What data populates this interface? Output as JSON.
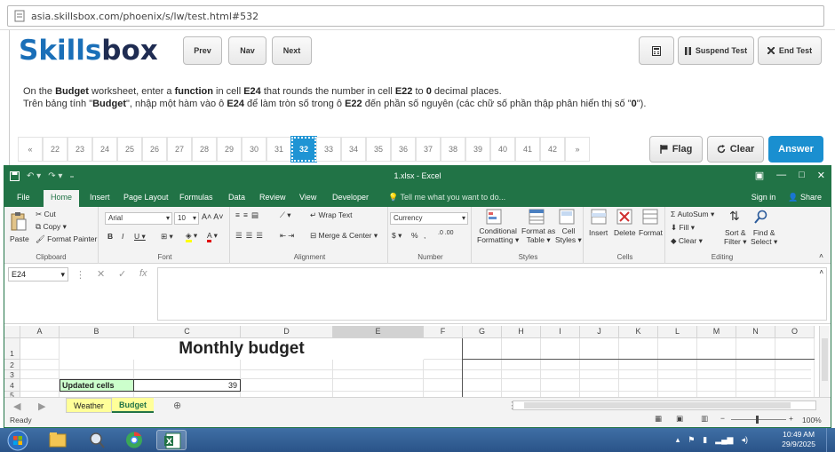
{
  "browser": {
    "url": "asia.skillsbox.com/phoenix/s/lw/test.html#532"
  },
  "test": {
    "logo_skills": "Skills",
    "logo_box": "box",
    "prev": "Prev",
    "nav": "Nav",
    "next": "Next",
    "suspend": "Suspend Test",
    "end": "End Test",
    "instruction_en": {
      "p1": "On the ",
      "b1": "Budget",
      "p2": " worksheet, enter a ",
      "b2": "function",
      "p3": " in cell ",
      "b3": "E24",
      "p4": " that rounds the number in cell ",
      "b4": "E22",
      "p5": " to ",
      "b5": "0",
      "p6": " decimal places."
    },
    "instruction_vi": {
      "p1": "Trên bảng tính \"",
      "b1": "Budget",
      "p2": "\", nhập một hàm vào ô ",
      "b2": "E24",
      "p3": " để làm tròn số trong ô ",
      "b3": "E22",
      "p4": " đến phần số nguyên (các chữ số phần thập phân hiển thị số \"",
      "b4": "0",
      "p5": "\")."
    },
    "pager": [
      "«",
      "22",
      "23",
      "24",
      "25",
      "26",
      "27",
      "28",
      "29",
      "30",
      "31",
      "32",
      "33",
      "34",
      "35",
      "36",
      "37",
      "38",
      "39",
      "40",
      "41",
      "42",
      "»"
    ],
    "active_page": "32",
    "flag": "Flag",
    "clear": "Clear",
    "answer": "Answer"
  },
  "excel": {
    "title": "1.xlsx - Excel",
    "tabs": [
      "File",
      "Home",
      "Insert",
      "Page Layout",
      "Formulas",
      "Data",
      "Review",
      "View",
      "Developer"
    ],
    "tell_me": "Tell me what you want to do...",
    "sign_in": "Sign in",
    "share": "Share",
    "ribbon": {
      "paste": "Paste",
      "cut": "Cut",
      "copy": "Copy",
      "format_painter": "Format Painter",
      "clipboard": "Clipboard",
      "font_name": "Arial",
      "font_size": "10",
      "font": "Font",
      "wrap_text": "Wrap Text",
      "merge_center": "Merge & Center",
      "alignment": "Alignment",
      "number_format": "Currency",
      "number": "Number",
      "conditional": "Conditional",
      "formatting": "Formatting",
      "format_as": "Format as",
      "table": "Table",
      "cell": "Cell",
      "styles_btn": "Styles",
      "styles": "Styles",
      "insert": "Insert",
      "delete": "Delete",
      "format": "Format",
      "cells": "Cells",
      "autosum": "AutoSum",
      "fill": "Fill",
      "clear": "Clear",
      "sort_filter": "Sort &",
      "filter": "Filter",
      "find_select": "Find &",
      "select": "Select",
      "editing": "Editing"
    },
    "name_box": "E24",
    "columns": [
      "A",
      "B",
      "C",
      "D",
      "E",
      "F",
      "G",
      "H",
      "I",
      "J",
      "K",
      "L",
      "M",
      "N",
      "O"
    ],
    "rows": [
      "1",
      "2",
      "3",
      "4",
      "5"
    ],
    "cells": {
      "c1": "Monthly budget",
      "b4": "Updated cells",
      "c4": "39"
    },
    "sheets": [
      "Weather",
      "Budget"
    ],
    "active_sheet": "Budget",
    "status_ready": "Ready",
    "zoom": "100%"
  },
  "taskbar": {
    "time": "10:49 AM",
    "date": "29/9/2025"
  },
  "colors": {
    "excel_green": "#217346",
    "skills_blue": "#1a6fb8",
    "answer_blue": "#1a8fd0",
    "sheet_tab_yellow": "#ffff99",
    "cell_green": "#ccffcc"
  }
}
